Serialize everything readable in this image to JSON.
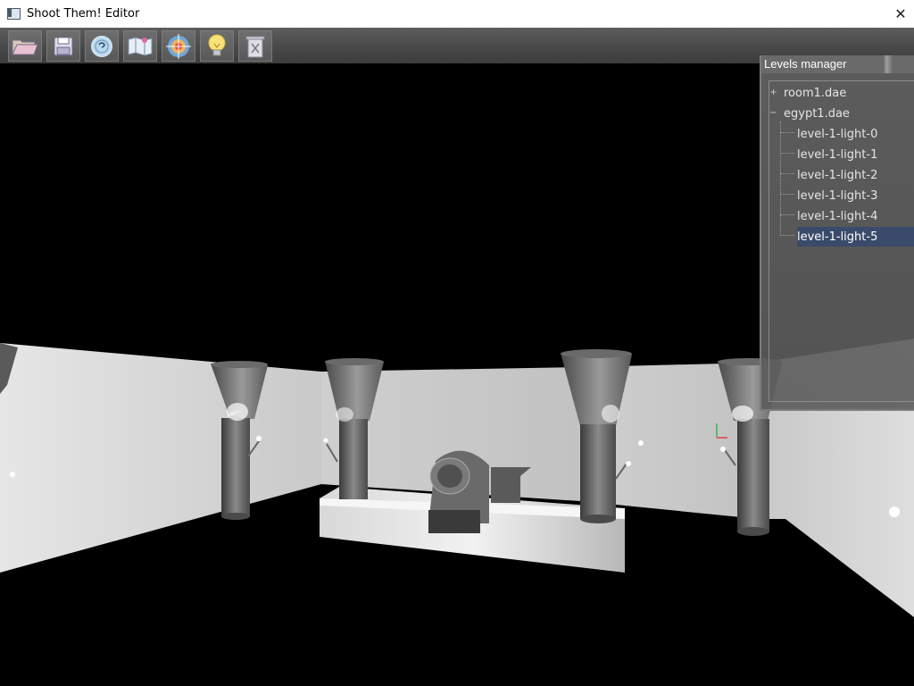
{
  "window": {
    "title": "Shoot Them! Editor",
    "close_glyph": "✕"
  },
  "toolbar": {
    "buttons": [
      {
        "name": "open-folder-icon",
        "interactable": true
      },
      {
        "name": "save-floppy-icon",
        "interactable": true
      },
      {
        "name": "help-compass-icon",
        "interactable": true
      },
      {
        "name": "map-icon",
        "interactable": true
      },
      {
        "name": "target-icon",
        "interactable": true
      },
      {
        "name": "light-bulb-icon",
        "interactable": true
      },
      {
        "name": "trash-delete-icon",
        "interactable": true
      }
    ]
  },
  "levels_manager": {
    "title": "Levels manager",
    "tree": [
      {
        "label": "room1.dae",
        "expander": "+",
        "expanded": false,
        "children": []
      },
      {
        "label": "egypt1.dae",
        "expander": "−",
        "expanded": true,
        "children": [
          {
            "label": "level-1-light-0",
            "selected": false
          },
          {
            "label": "level-1-light-1",
            "selected": false
          },
          {
            "label": "level-1-light-2",
            "selected": false
          },
          {
            "label": "level-1-light-3",
            "selected": false
          },
          {
            "label": "level-1-light-4",
            "selected": false
          },
          {
            "label": "level-1-light-5",
            "selected": true
          }
        ]
      }
    ]
  },
  "colors": {
    "selection": "#3a4a6a",
    "panel_bg": "#646464",
    "toolbar_bg": "#4a4a4a",
    "scene_wall": "#d0d0d0"
  }
}
